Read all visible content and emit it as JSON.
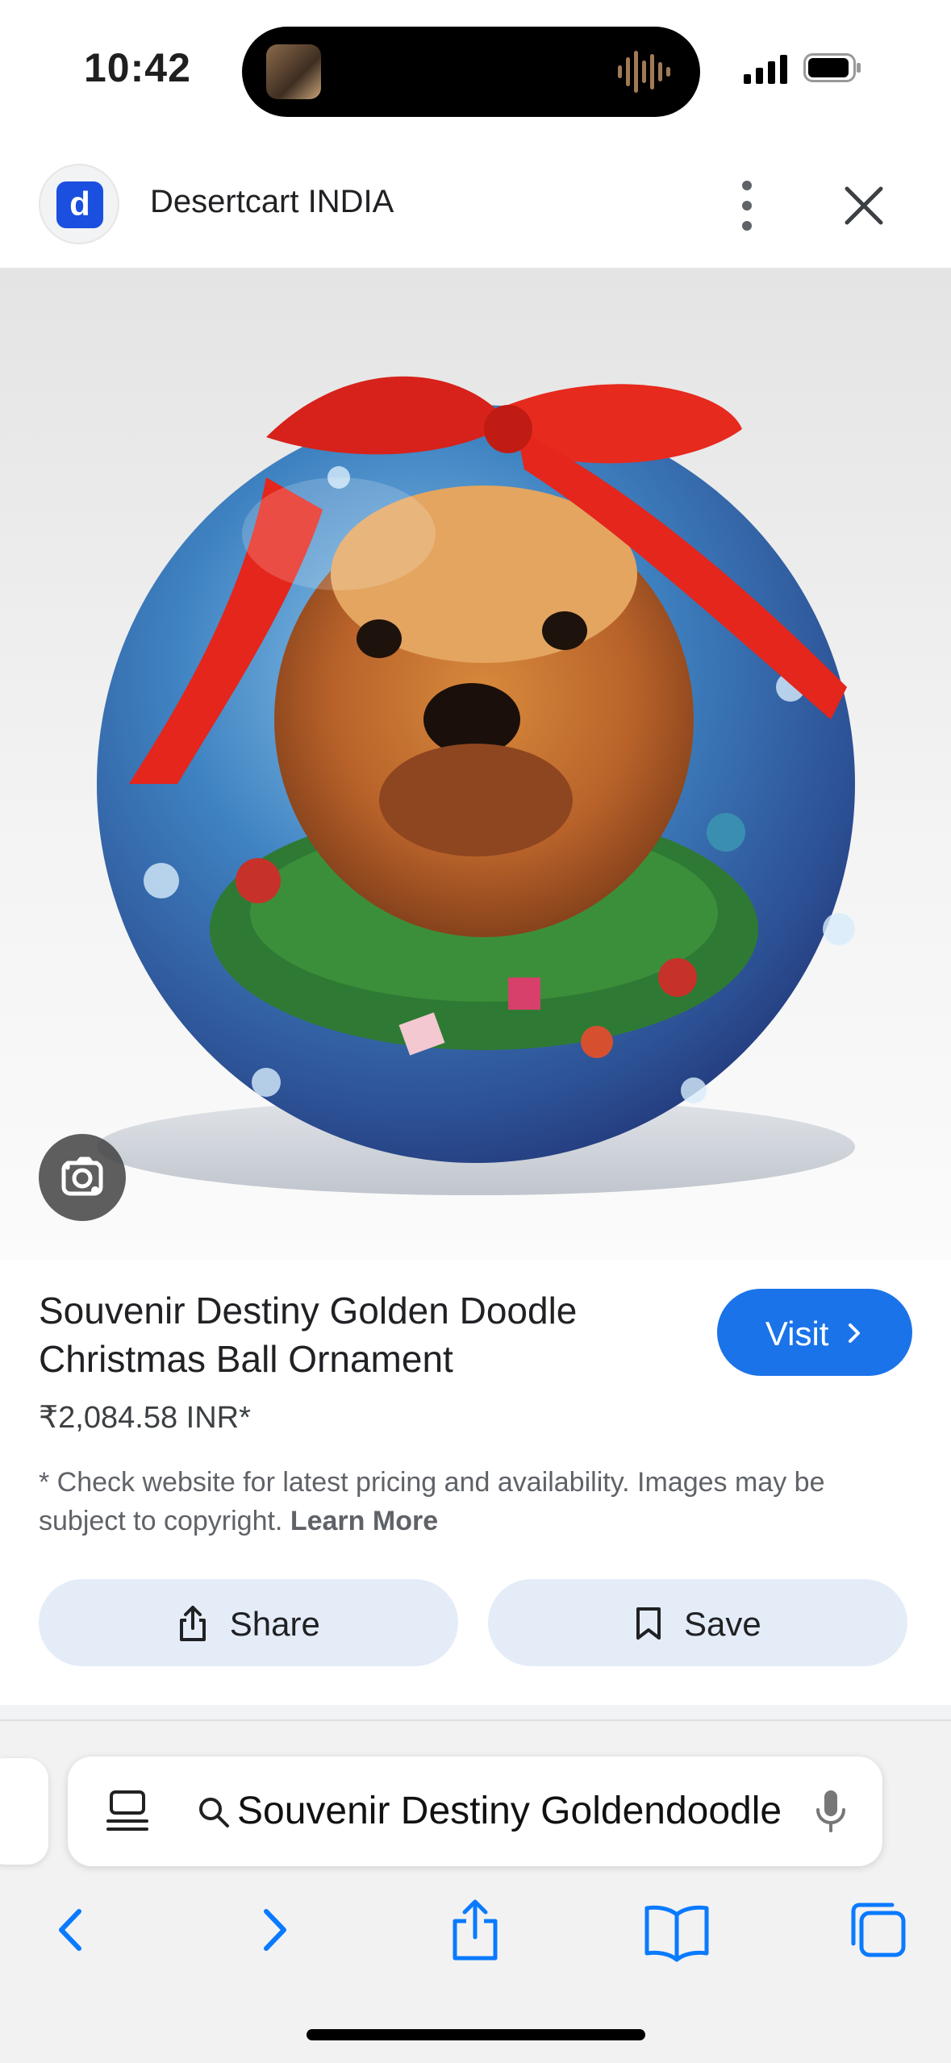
{
  "status_bar": {
    "time": "10:42"
  },
  "source": {
    "name": "Desertcart INDIA",
    "logo_letter": "d"
  },
  "product": {
    "title": "Souvenir Destiny Golden Doodle Christmas Ball Ornament",
    "price": "₹2,084.58 INR*",
    "disclaimer": "* Check website for latest pricing and availability. Images may be subject to copyright.",
    "learn_more": "Learn More"
  },
  "buttons": {
    "visit": "Visit",
    "share": "Share",
    "save": "Save"
  },
  "address_bar": {
    "text": "Souvenir Destiny Goldendoodle"
  },
  "colors": {
    "accent": "#1a73e8",
    "action_bg": "#e4ecf8",
    "brand_logo": "#1a4fe0",
    "safari_blue": "#0a7aff"
  }
}
